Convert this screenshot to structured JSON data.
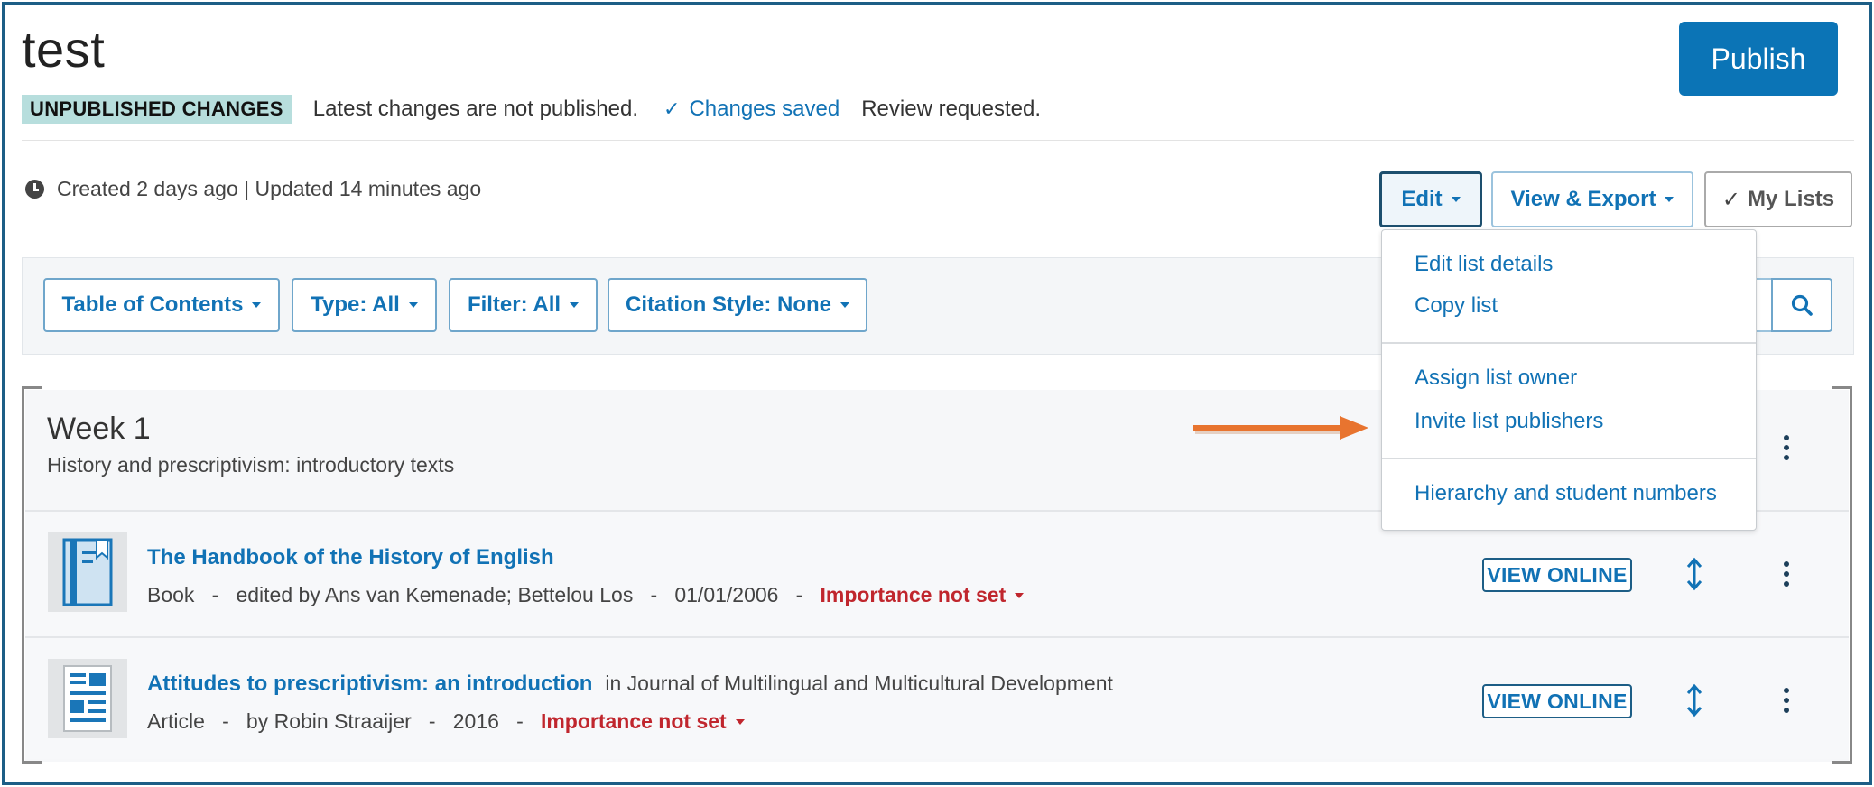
{
  "header": {
    "title": "test",
    "publish_label": "Publish",
    "badge": "UNPUBLISHED CHANGES",
    "status_text": "Latest changes are not published.",
    "saved_text": "Changes saved",
    "review_text": "Review requested."
  },
  "meta": {
    "created_updated": "Created 2 days ago | Updated 14 minutes ago"
  },
  "toolbar": {
    "edit_label": "Edit",
    "view_export_label": "View & Export",
    "my_lists_label": "My Lists"
  },
  "filters": {
    "toc_label": "Table of Contents",
    "type_label": "Type: All",
    "filter_label": "Filter: All",
    "citation_label": "Citation Style: None"
  },
  "edit_menu": {
    "items": [
      "Edit list details",
      "Copy list",
      "Assign list owner",
      "Invite list publishers",
      "Hierarchy and student numbers"
    ]
  },
  "section": {
    "title": "Week 1",
    "subtitle": "History and prescriptivism: introductory texts"
  },
  "items": [
    {
      "title": "The Handbook of the History of English",
      "journal": "",
      "type": "Book",
      "authors": "edited by Ans van Kemenade; Bettelou Los",
      "date": "01/01/2006",
      "importance": "Importance not set",
      "view_online": "VIEW ONLINE"
    },
    {
      "title": "Attitudes to prescriptivism: an introduction",
      "journal": "in Journal of Multilingual and Multicultural Development",
      "type": "Article",
      "authors": "by Robin Straaijer",
      "date": "2016",
      "importance": "Importance not set",
      "view_online": "VIEW ONLINE"
    }
  ],
  "separators": {
    "dash": "-"
  },
  "colors": {
    "accent": "#1172b5",
    "publish_bg": "#0b74b6",
    "badge_bg": "#b7dedd",
    "importance": "#c0262d",
    "arrow": "#e8742f",
    "frame": "#1d5e86"
  },
  "icons": [
    "clock-icon",
    "check-icon",
    "caret-down-icon",
    "search-icon",
    "kebab-icon",
    "book-icon",
    "article-icon",
    "move-updown-icon",
    "annotation-arrow"
  ]
}
